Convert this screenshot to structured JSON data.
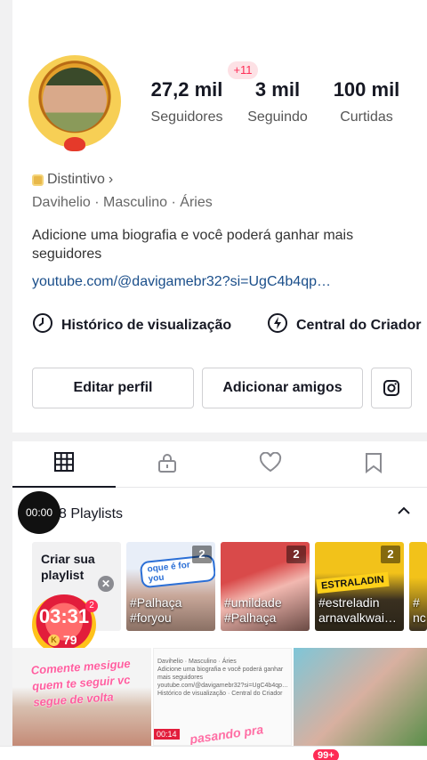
{
  "profile": {
    "notification_badge": "+11",
    "stats": [
      {
        "value": "27,2 mil",
        "label": "Seguidores"
      },
      {
        "value": "3 mil",
        "label": "Seguindo"
      },
      {
        "value": "100 mil",
        "label": "Curtidas"
      }
    ],
    "distintivo": "Distintivo",
    "distintivo_chevron": "›",
    "meta": "Davihelio · Masculino · Áries",
    "bio": "Adicione uma biografia e você poderá ganhar mais seguidores",
    "link": "youtube.com/@davigamebr32?si=UgC4b4qp…"
  },
  "tools": {
    "history": "Histórico de visualização",
    "creator": "Central do Criador"
  },
  "buttons": {
    "edit": "Editar perfil",
    "add_friends": "Adicionar amigos",
    "instagram_icon": "instagram-icon"
  },
  "tabs": [
    "grid-icon",
    "lock-icon",
    "heart-icon",
    "bookmark-icon"
  ],
  "playlists": {
    "timer": "00:00",
    "title": "8 Playlists",
    "create": "Criar sua playlist",
    "items": [
      {
        "count": "2",
        "tag1": "#Palhaça",
        "tag2": "#foryou",
        "sticker": "oque é for you"
      },
      {
        "count": "2",
        "tag1": "#umildade",
        "tag2": "#Palhaça"
      },
      {
        "count": "2",
        "tag1": "#estreladin",
        "tag2": "arnavalkwai…",
        "sticker": "ESTRALADIN"
      },
      {
        "count": "",
        "tag1": "#",
        "tag2": "nc"
      }
    ]
  },
  "live_widget": {
    "time": "03:31",
    "coins": "79",
    "badge": "2"
  },
  "videos": {
    "v1_text": "Comente mesigue quem te seguir vc segue de volta",
    "v2_mini": "Davihelio · Masculino · Áries\nAdicione uma biografia e você poderá ganhar mais seguidores\nyoutube.com/@davigamebr32?si=UgC4b4qp…\nHistórico de visualização · Central do Criador",
    "v2_time": "00:14",
    "v2_text": "pasando pra"
  },
  "nav_badge": "99+",
  "colors": {
    "accent": "#fe2c55",
    "link": "#1a4e8a",
    "text": "#161823"
  }
}
